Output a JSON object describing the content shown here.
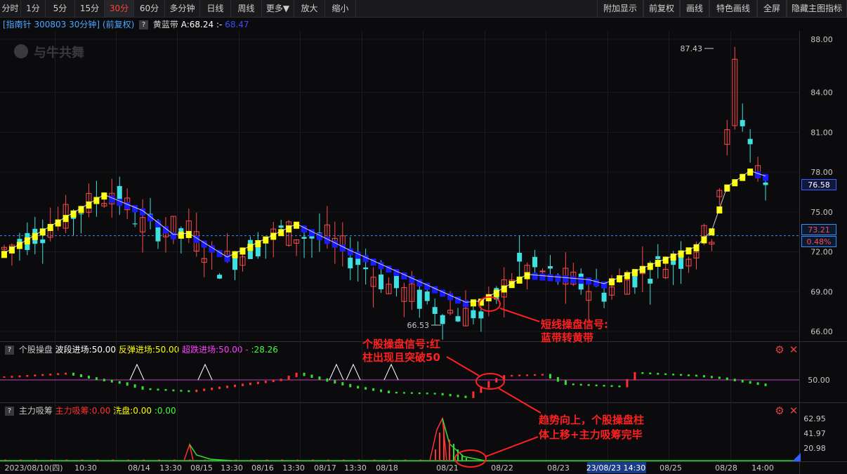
{
  "toolbar": {
    "left_items": [
      "分时",
      "1分",
      "5分",
      "15分",
      "30分",
      "60分",
      "多分钟",
      "日线",
      "周线",
      "更多▼",
      "放大",
      "缩小"
    ],
    "active_label": "30分",
    "right_items": [
      "附加显示",
      "前复权",
      "画线",
      "特色画线",
      "全屏",
      "隐藏主图指标"
    ]
  },
  "header": {
    "stock": "[指南针 300803 30分钟] (前复权)",
    "indicator_name": "黄蓝带",
    "a_label": "A:68.24",
    "b_label": ":-",
    "b_value": "68.47",
    "watermark": "与牛共舞"
  },
  "price_axis": {
    "ticks": [
      "88.00",
      "84.00",
      "81.00",
      "78.00",
      "75.00",
      "72.00",
      "69.00",
      "66.00"
    ],
    "current_price": "76.58",
    "ref_price": "73.21",
    "change_pct": "0.48%"
  },
  "marks": {
    "high": "87.43",
    "low": "66.53"
  },
  "annotations": {
    "signal_line1": "短线操盘信号:",
    "signal_line2": "蓝带转黄带",
    "stock_line1": "个股操盘信号:红",
    "stock_line2": "柱出现且突破50",
    "trend_line1": "趋势向上，个股操盘柱",
    "trend_line2": "体上移+主力吸筹完毕"
  },
  "indicator1": {
    "name": "个股操盘",
    "a_label": "波段进场:50.00",
    "b_label": "反弹进场:50.00",
    "c_label": "超跌进场:50.00",
    "d_label": ":28.26",
    "level_label": "50.00",
    "colors": {
      "name": "#c8c8c8",
      "a": "#ffffff",
      "b": "#ffff00",
      "c": "#ff40ff",
      "d": "#40ff40"
    }
  },
  "indicator2": {
    "name": "主力吸筹",
    "a_label": "主力吸筹:0.00",
    "b_label": "洗盘:0.00",
    "c_label": ":0.00",
    "ticks": [
      "62.95",
      "41.97",
      "20.98"
    ],
    "colors": {
      "a": "#ff3030",
      "b": "#ffff00",
      "c": "#40ff40"
    }
  },
  "time_axis": {
    "labels": [
      "2023/08/10(四)",
      "10:30",
      "08/14",
      "13:30",
      "08/15",
      "13:30",
      "08/16",
      "13:30",
      "08/17",
      "13:30",
      "08/18",
      "08/21",
      "08/22",
      "08/23",
      "23/08/23 14:30",
      "08/25",
      "08/28",
      "14:00"
    ]
  },
  "colors": {
    "up": "#ff4a4a",
    "down": "#40e0e0",
    "band_up": "#ffff00",
    "band_down": "#1a1aff",
    "ref_line": "#3090ff",
    "annotation": "#ff2020"
  }
}
